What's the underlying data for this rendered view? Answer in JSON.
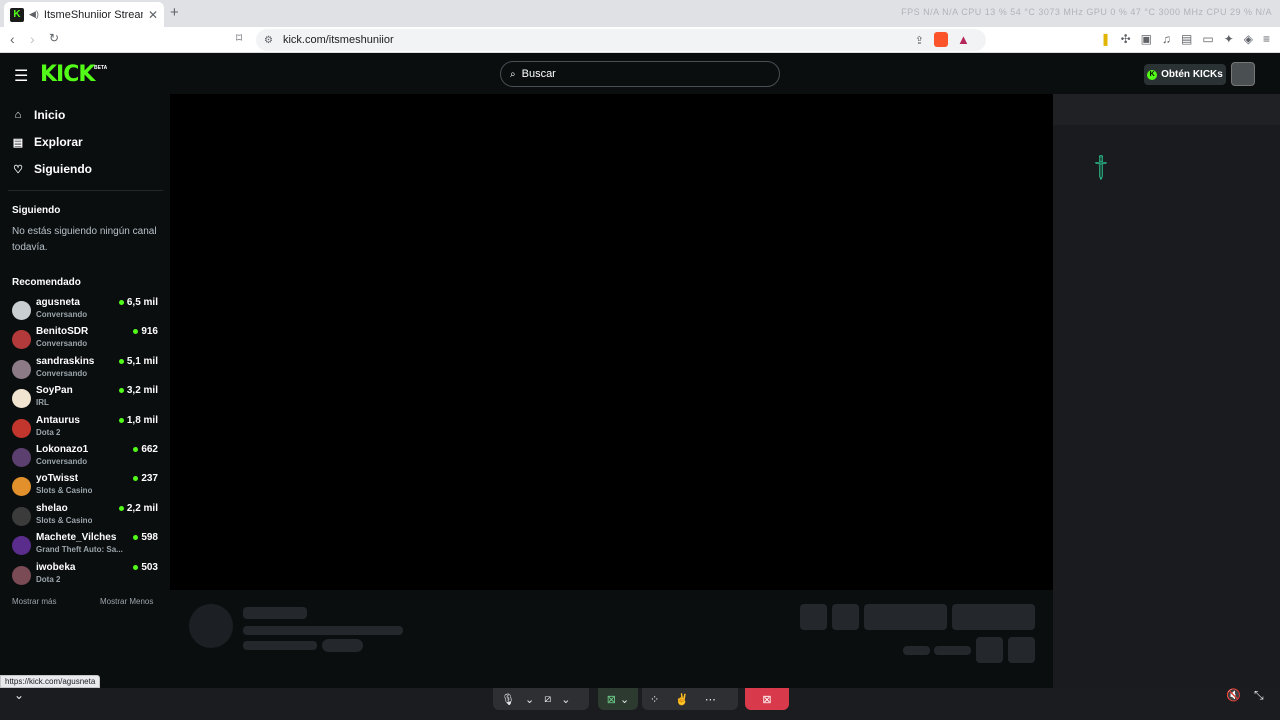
{
  "browser": {
    "tab_title": "ItsmeShuniior Stream - Watch",
    "tab_close": "✕",
    "new_tab": "+",
    "url": "kick.com/itsmeshuniior",
    "system_stats": "FPS N/A  N/A   CPU 13 % 54 °C  3073 MHz  GPU 0 % 47 °C  3000 MHz   CPU 29 %   N/A"
  },
  "header": {
    "logo": "KICK",
    "logo_badge": "BETA",
    "search_placeholder": "Buscar",
    "kicks_button": "Obtén KICKs"
  },
  "sidebar": {
    "nav": [
      {
        "label": "Inicio",
        "icon": "home-icon"
      },
      {
        "label": "Explorar",
        "icon": "browse-icon"
      },
      {
        "label": "Siguiendo",
        "icon": "heart-icon"
      }
    ],
    "following_title": "Siguiendo",
    "following_empty": "No estás siguiendo ningún canal todavía.",
    "recommended_title": "Recomendado",
    "recommended": [
      {
        "name": "agusneta",
        "category": "Conversando",
        "viewers": "6,5 mil",
        "color": "#c9ced1"
      },
      {
        "name": "BenitoSDR",
        "category": "Conversando",
        "viewers": "916",
        "color": "#b33a3a"
      },
      {
        "name": "sandraskins",
        "category": "Conversando",
        "viewers": "5,1 mil",
        "color": "#8c7b86"
      },
      {
        "name": "SoyPan",
        "category": "IRL",
        "viewers": "3,2 mil",
        "color": "#f1e4d0"
      },
      {
        "name": "Antaurus",
        "category": "Dota 2",
        "viewers": "1,8 mil",
        "color": "#c2362d"
      },
      {
        "name": "Lokonazo1",
        "category": "Conversando",
        "viewers": "662",
        "color": "#5b3f6e"
      },
      {
        "name": "yoTwisst",
        "category": "Slots & Casino",
        "viewers": "237",
        "color": "#e1902b"
      },
      {
        "name": "shelao",
        "category": "Slots & Casino",
        "viewers": "2,2 mil",
        "color": "#3b3b3b"
      },
      {
        "name": "Machete_Vilches",
        "category": "Grand Theft Auto: Sa...",
        "viewers": "598",
        "color": "#5a2c8c"
      },
      {
        "name": "iwobeka",
        "category": "Dota 2",
        "viewers": "503",
        "color": "#7a4a55"
      }
    ],
    "show_more": "Mostrar más",
    "show_less": "Mostrar Menos"
  },
  "status_bar": {
    "link": "https://kick.com/agusneta"
  },
  "colors": {
    "accent": "#53fc18",
    "background": "#0b0e0f",
    "player": "#000000",
    "leave_button": "#d93a4b"
  }
}
